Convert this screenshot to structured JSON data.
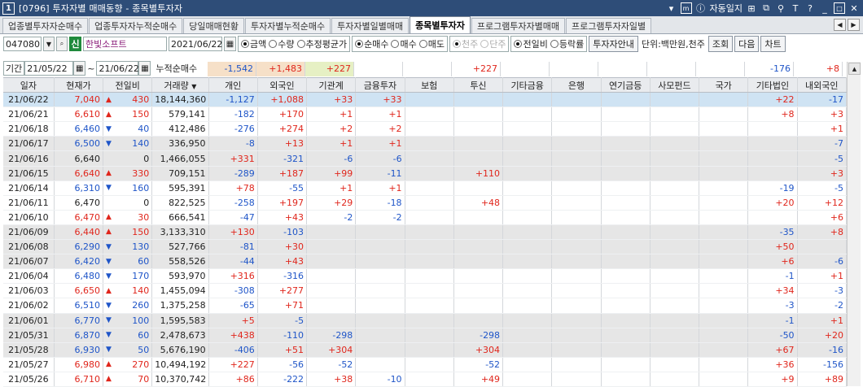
{
  "title": {
    "num": "1",
    "text": "[0796] 투자자별 매매동향 - 종목별투자자",
    "auto_label": "자동일지"
  },
  "tabs": [
    "업종별투자자순매수",
    "업종투자자누적순매수",
    "당일매매현황",
    "투자자별누적순매수",
    "투자자별일별매매",
    "종목별투자자",
    "프로그램투자자별매매",
    "프로그램투자자일별"
  ],
  "toolbar": {
    "code": "047080",
    "sin": "신",
    "name": "한빛소프트",
    "date": "2021/06/22",
    "opt1": [
      "금액",
      "수량",
      "추정평균가"
    ],
    "opt2": [
      "순매수",
      "매수",
      "매도"
    ],
    "opt3": [
      "천주",
      "단주"
    ],
    "opt4": [
      "전일비",
      "등락률"
    ],
    "btn_investor": "투자자안내",
    "unit": "단위:백만원,천주",
    "btn_query": "조회",
    "btn_next": "다음",
    "btn_chart": "차트"
  },
  "period": {
    "label": "기간",
    "from": "21/05/22",
    "to": "21/06/22",
    "cum_label": "누적순매수",
    "cum": {
      "p": "-1,542",
      "f": "+1,483",
      "ins": "+227",
      "fin": "",
      "ins2": "",
      "tr": "+227",
      "etc": "",
      "bank": "",
      "pen": "",
      "pf": "",
      "nat": "",
      "corp": "-176",
      "dom": "+8"
    }
  },
  "headers": [
    "일자",
    "현재가",
    "전일비",
    "거래량",
    "개인",
    "외국인",
    "기관계",
    "금융투자",
    "보험",
    "투신",
    "기타금융",
    "은행",
    "연기금등",
    "사모펀드",
    "국가",
    "기타법인",
    "내외국인"
  ],
  "rows": [
    {
      "d": "21/06/22",
      "price": "7,040",
      "dir": "up",
      "chg": "430",
      "vol": "18,144,360",
      "p": "-1,127",
      "f": "+1,088",
      "ins": "+33",
      "fin": "+33",
      "tr": "",
      "corp": "+22",
      "dom": "-17",
      "hl": true
    },
    {
      "d": "21/06/21",
      "price": "6,610",
      "dir": "up",
      "chg": "150",
      "vol": "579,141",
      "p": "-182",
      "f": "+170",
      "ins": "+1",
      "fin": "+1",
      "tr": "",
      "corp": "+8",
      "dom": "+3"
    },
    {
      "d": "21/06/18",
      "price": "6,460",
      "dir": "dn",
      "chg": "40",
      "vol": "412,486",
      "p": "-276",
      "f": "+274",
      "ins": "+2",
      "fin": "+2",
      "tr": "",
      "corp": "",
      "dom": "+1"
    },
    {
      "d": "21/06/17",
      "price": "6,500",
      "dir": "dn",
      "chg": "140",
      "vol": "336,950",
      "p": "-8",
      "f": "+13",
      "ins": "+1",
      "fin": "+1",
      "tr": "",
      "corp": "",
      "dom": "-7",
      "g": true
    },
    {
      "d": "21/06/16",
      "price": "6,640",
      "dir": "",
      "chg": "0",
      "vol": "1,466,055",
      "p": "+331",
      "f": "-321",
      "ins": "-6",
      "fin": "-6",
      "tr": "",
      "corp": "",
      "dom": "-5",
      "g": true
    },
    {
      "d": "21/06/15",
      "price": "6,640",
      "dir": "up",
      "chg": "330",
      "vol": "709,151",
      "p": "-289",
      "f": "+187",
      "ins": "+99",
      "fin": "-11",
      "tr": "+110",
      "corp": "",
      "dom": "+3",
      "g": true
    },
    {
      "d": "21/06/14",
      "price": "6,310",
      "dir": "dn",
      "chg": "160",
      "vol": "595,391",
      "p": "+78",
      "f": "-55",
      "ins": "+1",
      "fin": "+1",
      "tr": "",
      "corp": "-19",
      "dom": "-5"
    },
    {
      "d": "21/06/11",
      "price": "6,470",
      "dir": "",
      "chg": "0",
      "vol": "822,525",
      "p": "-258",
      "f": "+197",
      "ins": "+29",
      "fin": "-18",
      "tr": "+48",
      "corp": "+20",
      "dom": "+12"
    },
    {
      "d": "21/06/10",
      "price": "6,470",
      "dir": "up",
      "chg": "30",
      "vol": "666,541",
      "p": "-47",
      "f": "+43",
      "ins": "-2",
      "fin": "-2",
      "tr": "",
      "corp": "",
      "dom": "+6"
    },
    {
      "d": "21/06/09",
      "price": "6,440",
      "dir": "up",
      "chg": "150",
      "vol": "3,133,310",
      "p": "+130",
      "f": "-103",
      "ins": "",
      "fin": "",
      "tr": "",
      "corp": "-35",
      "dom": "+8",
      "g": true
    },
    {
      "d": "21/06/08",
      "price": "6,290",
      "dir": "dn",
      "chg": "130",
      "vol": "527,766",
      "p": "-81",
      "f": "+30",
      "ins": "",
      "fin": "",
      "tr": "",
      "corp": "+50",
      "dom": "",
      "g": true
    },
    {
      "d": "21/06/07",
      "price": "6,420",
      "dir": "dn",
      "chg": "60",
      "vol": "558,526",
      "p": "-44",
      "f": "+43",
      "ins": "",
      "fin": "",
      "tr": "",
      "corp": "+6",
      "dom": "-6",
      "g": true
    },
    {
      "d": "21/06/04",
      "price": "6,480",
      "dir": "dn",
      "chg": "170",
      "vol": "593,970",
      "p": "+316",
      "f": "-316",
      "ins": "",
      "fin": "",
      "tr": "",
      "corp": "-1",
      "dom": "+1"
    },
    {
      "d": "21/06/03",
      "price": "6,650",
      "dir": "up",
      "chg": "140",
      "vol": "1,455,094",
      "p": "-308",
      "f": "+277",
      "ins": "",
      "fin": "",
      "tr": "",
      "corp": "+34",
      "dom": "-3"
    },
    {
      "d": "21/06/02",
      "price": "6,510",
      "dir": "dn",
      "chg": "260",
      "vol": "1,375,258",
      "p": "-65",
      "f": "+71",
      "ins": "",
      "fin": "",
      "tr": "",
      "corp": "-3",
      "dom": "-2"
    },
    {
      "d": "21/06/01",
      "price": "6,770",
      "dir": "dn",
      "chg": "100",
      "vol": "1,595,583",
      "p": "+5",
      "f": "-5",
      "ins": "",
      "fin": "",
      "tr": "",
      "corp": "-1",
      "dom": "+1",
      "g": true
    },
    {
      "d": "21/05/31",
      "price": "6,870",
      "dir": "dn",
      "chg": "60",
      "vol": "2,478,673",
      "p": "+438",
      "f": "-110",
      "ins": "-298",
      "fin": "",
      "tr": "-298",
      "corp": "-50",
      "dom": "+20",
      "g": true
    },
    {
      "d": "21/05/28",
      "price": "6,930",
      "dir": "dn",
      "chg": "50",
      "vol": "5,676,190",
      "p": "-406",
      "f": "+51",
      "ins": "+304",
      "fin": "",
      "tr": "+304",
      "corp": "+67",
      "dom": "-16",
      "g": true
    },
    {
      "d": "21/05/27",
      "price": "6,980",
      "dir": "up",
      "chg": "270",
      "vol": "10,494,192",
      "p": "+227",
      "f": "-56",
      "ins": "-52",
      "fin": "",
      "tr": "-52",
      "corp": "+36",
      "dom": "-156"
    },
    {
      "d": "21/05/26",
      "price": "6,710",
      "dir": "up",
      "chg": "70",
      "vol": "10,370,742",
      "p": "+86",
      "f": "-222",
      "ins": "+38",
      "fin": "-10",
      "tr": "+49",
      "corp": "+9",
      "dom": "+89"
    }
  ]
}
